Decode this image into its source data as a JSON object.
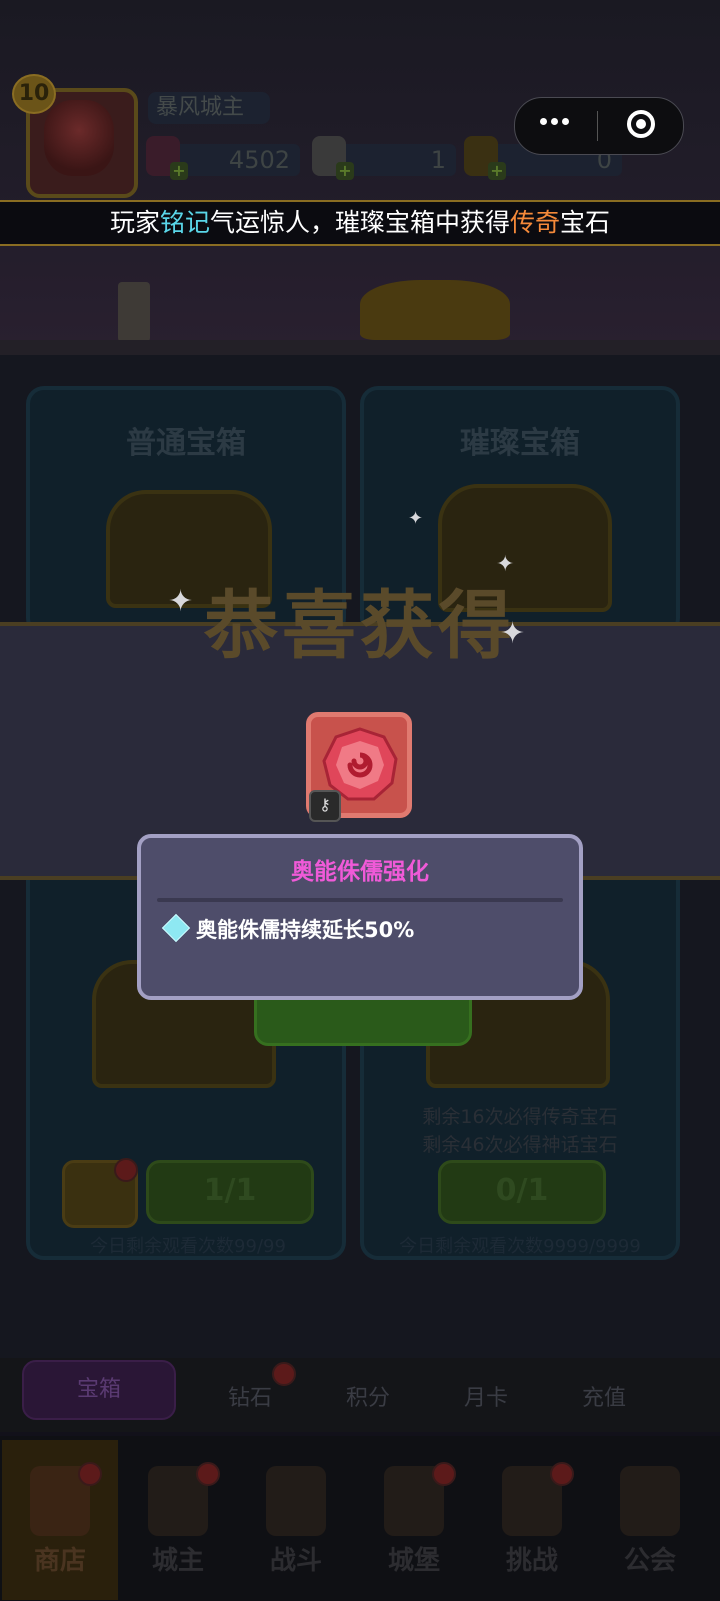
{
  "player": {
    "level": "10",
    "name": "暴风城主",
    "resources": [
      {
        "icon": "pink-gem-icon",
        "value": "4502"
      },
      {
        "icon": "pink-key-icon",
        "value": "1"
      },
      {
        "icon": "gold-key-icon",
        "value": "0"
      }
    ]
  },
  "broadcast": {
    "prefix": "玩家",
    "player_name": "铭记",
    "middle": "气运惊人，璀璨宝箱中获得",
    "rarity": "传奇",
    "suffix": "宝石"
  },
  "chests": {
    "normal": {
      "title": "普通宝箱",
      "button": "1/1",
      "footer": "今日剩余观看次数99/99"
    },
    "brilliant": {
      "title": "璀璨宝箱",
      "note_1": "剩余16次必得传奇宝石",
      "note_2": "剩余46次必得神话宝石",
      "button": "0/1",
      "footer": "今日剩余观看次数9999/9999"
    }
  },
  "shop_tabs": [
    "宝箱",
    "钻石",
    "积分",
    "月卡",
    "充值"
  ],
  "bottom_nav": [
    "商店",
    "城主",
    "战斗",
    "城堡",
    "挑战",
    "公会"
  ],
  "reward": {
    "heading": "恭喜获得",
    "item_icon": "red-spiral-gem-icon",
    "item_name": "奥能侏儒强化",
    "effect": "奥能侏儒持续延长50%"
  },
  "colors": {
    "tooltip_title": "#f05ad8",
    "highlight_name": "#5ad6e8",
    "highlight_rarity": "#f58a3a"
  }
}
